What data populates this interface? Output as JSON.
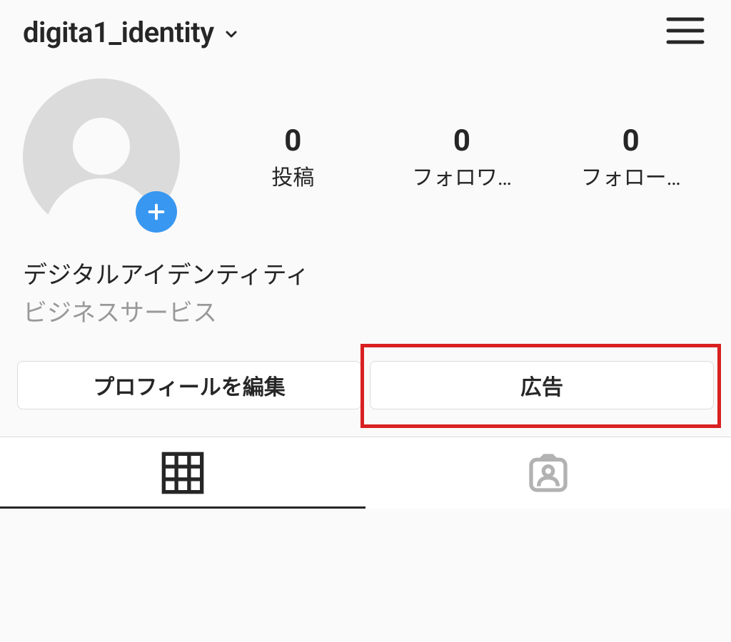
{
  "header": {
    "username": "digita1_identity"
  },
  "stats": {
    "posts": {
      "count": "0",
      "label": "投稿"
    },
    "followers": {
      "count": "0",
      "label": "フォロワ…"
    },
    "following": {
      "count": "0",
      "label": "フォロー…"
    }
  },
  "bio": {
    "display_name": "デジタルアイデンティティ",
    "category": "ビジネスサービス"
  },
  "buttons": {
    "edit_profile": "プロフィールを編集",
    "ads": "広告"
  }
}
